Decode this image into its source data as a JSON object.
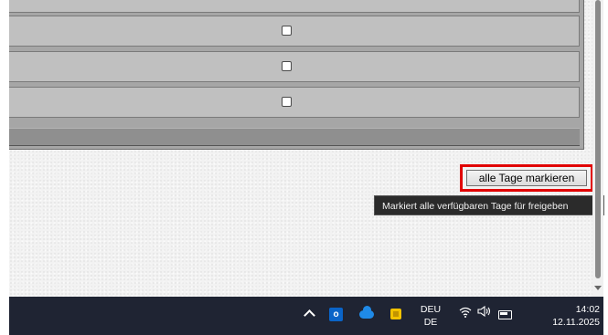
{
  "table": {
    "rows": [
      {
        "checkbox_checked": false
      },
      {
        "checkbox_checked": false
      },
      {
        "checkbox_checked": false
      }
    ]
  },
  "actions": {
    "mark_all_label": "alle Tage markieren",
    "mark_all_tooltip": "Markiert alle verfügbaren Tage für freigeben"
  },
  "taskbar": {
    "icons": [
      "chevron-up-icon",
      "outlook-icon",
      "onedrive-cloud-icon",
      "chip-icon",
      "wifi-icon",
      "speaker-icon",
      "battery-icon"
    ],
    "language_primary": "DEU",
    "language_secondary": "DE",
    "time": "14:02",
    "date": "12.11.2025"
  },
  "colors": {
    "highlight": "#e10000",
    "taskbar_bg": "#1f2433",
    "tooltip_bg": "#2b2b2b"
  }
}
